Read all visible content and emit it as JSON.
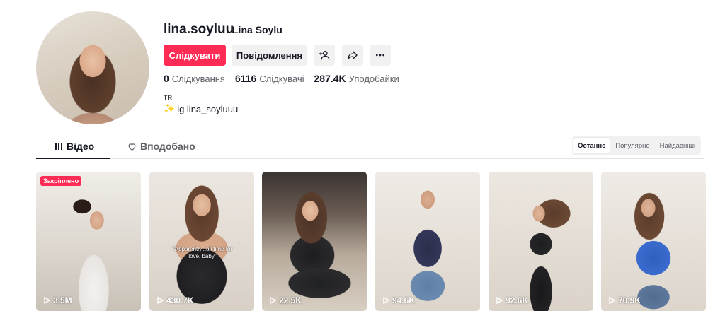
{
  "profile": {
    "username": "lina.soyluu",
    "nickname": "Lina Soylu",
    "country": "TR",
    "bio": "ig lina_soyluuu",
    "bio_icon": "sparkles-icon"
  },
  "actions": {
    "follow_label": "Слідкувати",
    "message_label": "Повідомлення",
    "follow_color": "#fe2c55"
  },
  "stats": [
    {
      "value": "0",
      "label": "Слідкування"
    },
    {
      "value": "6116",
      "label": "Слідкувачі"
    },
    {
      "value": "287.4K",
      "label": "Уподобайки"
    }
  ],
  "tabs": [
    {
      "label": "Відео",
      "active": true
    },
    {
      "label": "Вподобано",
      "active": false
    }
  ],
  "sort": [
    {
      "label": "Останнє",
      "active": true
    },
    {
      "label": "Популярне",
      "active": false
    },
    {
      "label": "Найдавніші",
      "active": false
    }
  ],
  "videos": [
    {
      "views": "3.5M",
      "pinned_label": "Закріплено"
    },
    {
      "views": "430.7K",
      "caption": "\"Apparently...all time for love, baby\""
    },
    {
      "views": "22.5K"
    },
    {
      "views": "94.6K"
    },
    {
      "views": "92.6K"
    },
    {
      "views": "70.9K"
    }
  ]
}
